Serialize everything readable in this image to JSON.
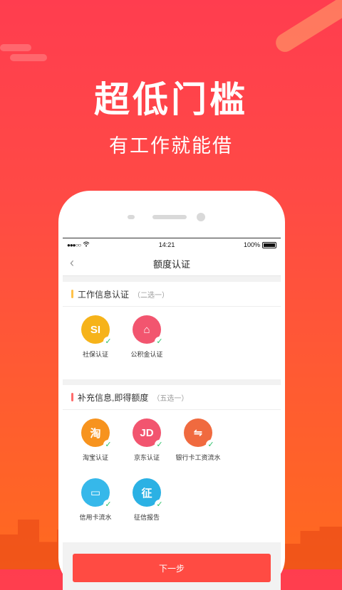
{
  "hero": {
    "title": "超低门槛",
    "subtitle": "有工作就能借"
  },
  "statusbar": {
    "signal": "●●●○○",
    "time": "14:21",
    "battery": "100%"
  },
  "navbar": {
    "back_icon": "‹",
    "title": "额度认证"
  },
  "sections": [
    {
      "title": "工作信息认证",
      "hint": "（二选一）",
      "accent": "#ffc24a",
      "items": [
        {
          "label": "社保认证",
          "icon_name": "social-security-icon",
          "glyph": "SI",
          "color": "#f6b31a"
        },
        {
          "label": "公积金认证",
          "icon_name": "housing-fund-icon",
          "glyph": "⌂",
          "color": "#f2556f"
        }
      ]
    },
    {
      "title": "补充信息,即得额度",
      "hint": "（五选一）",
      "accent": "#ff6b6b",
      "items": [
        {
          "label": "淘宝认证",
          "icon_name": "taobao-icon",
          "glyph": "淘",
          "color": "#f7931e"
        },
        {
          "label": "京东认证",
          "icon_name": "jd-icon",
          "glyph": "JD",
          "color": "#f2556f"
        },
        {
          "label": "银行卡工资流水",
          "icon_name": "bank-card-icon",
          "glyph": "⇋",
          "color": "#f06a3f"
        },
        {
          "label": "信用卡流水",
          "icon_name": "credit-card-icon",
          "glyph": "▭",
          "color": "#36b8ea"
        },
        {
          "label": "征信报告",
          "icon_name": "credit-report-icon",
          "glyph": "征",
          "color": "#2bb1e4"
        }
      ]
    }
  ],
  "next_button": "下一步",
  "check_glyph": "✓"
}
